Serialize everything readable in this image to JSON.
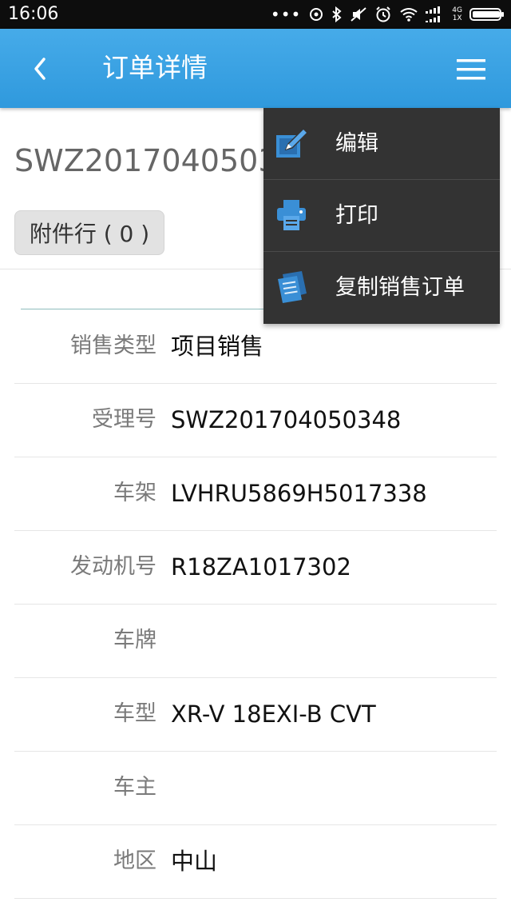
{
  "status_bar": {
    "time": "16:06",
    "icons": [
      "more-dots-icon",
      "sync-icon",
      "bluetooth-icon",
      "mute-icon",
      "alarm-icon",
      "wifi-icon",
      "signal-icon",
      "battery-icon"
    ],
    "network_top": "4G",
    "network_bottom": "1X",
    "dots": "•••"
  },
  "header": {
    "title": "订单详情",
    "back_icon": "chevron-left-icon",
    "menu_icon": "hamburger-menu-icon"
  },
  "order": {
    "number": "SWZ2017040503",
    "attachment_button": "附件行 ( 0 )"
  },
  "details": [
    {
      "label": "销售类型",
      "value": "项目销售"
    },
    {
      "label": "受理号",
      "value": "SWZ201704050348"
    },
    {
      "label": "车架",
      "value": "LVHRU5869H5017338"
    },
    {
      "label": "发动机号",
      "value": "R18ZA1017302"
    },
    {
      "label": "车牌",
      "value": ""
    },
    {
      "label": "车型",
      "value": "XR-V 18EXI-B CVT"
    },
    {
      "label": "车主",
      "value": ""
    },
    {
      "label": "地区",
      "value": "中山"
    }
  ],
  "dropdown_menu": {
    "items": [
      {
        "label": "编辑",
        "icon": "edit-icon"
      },
      {
        "label": "打印",
        "icon": "printer-icon"
      },
      {
        "label": "复制销售订单",
        "icon": "copy-document-icon"
      }
    ]
  },
  "colors": {
    "header": "#3aa3e4",
    "menu_bg": "#333333",
    "icon_blue": "#3a8fd6",
    "label_gray": "#7a7a7a"
  }
}
